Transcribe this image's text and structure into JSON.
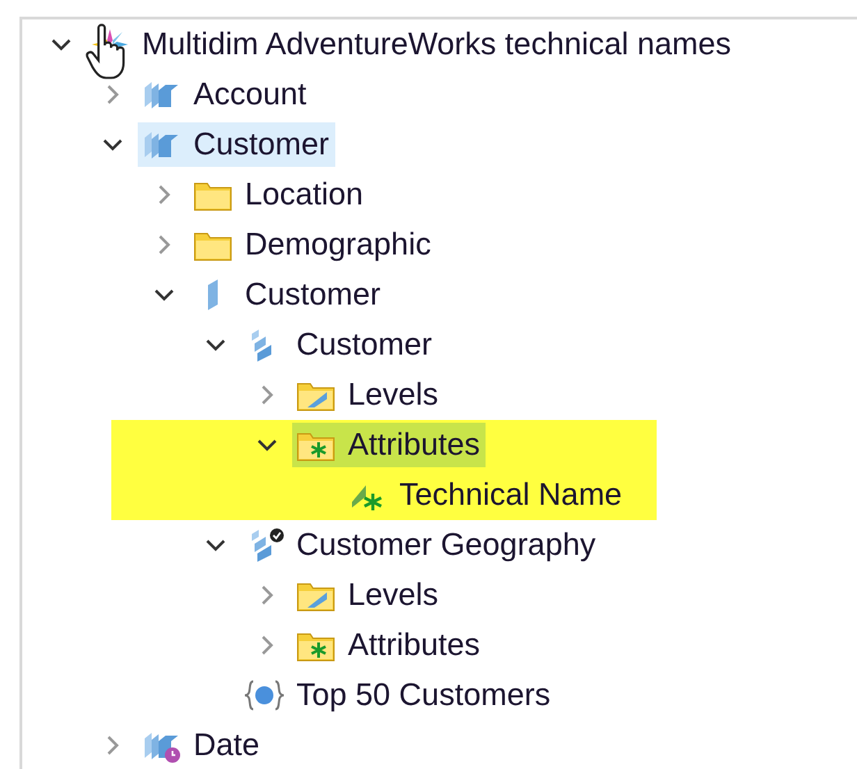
{
  "tree": [
    {
      "label": "Multidim AdventureWorks technical names",
      "kind": "project",
      "expanded": true,
      "selected": false,
      "highlighted": false,
      "children": [
        {
          "label": "Account",
          "kind": "cube",
          "expanded": false,
          "selected": false,
          "highlighted": false
        },
        {
          "label": "Customer",
          "kind": "cube",
          "expanded": true,
          "selected": true,
          "highlighted": false,
          "children": [
            {
              "label": "Location",
              "kind": "folder",
              "expanded": false,
              "selected": false,
              "highlighted": false
            },
            {
              "label": "Demographic",
              "kind": "folder",
              "expanded": false,
              "selected": false,
              "highlighted": false
            },
            {
              "label": "Customer",
              "kind": "dimension",
              "expanded": true,
              "selected": false,
              "highlighted": false,
              "children": [
                {
                  "label": "Customer",
                  "kind": "hierarchy",
                  "expanded": true,
                  "selected": false,
                  "highlighted": false,
                  "children": [
                    {
                      "label": "Levels",
                      "kind": "levels-folder",
                      "expanded": false,
                      "selected": false,
                      "highlighted": false
                    },
                    {
                      "label": "Attributes",
                      "kind": "attributes-folder",
                      "expanded": true,
                      "selected": true,
                      "highlighted": true,
                      "children": [
                        {
                          "label": "Technical Name",
                          "kind": "attribute",
                          "selected": false,
                          "highlighted": true
                        }
                      ]
                    }
                  ]
                },
                {
                  "label": "Customer Geography",
                  "kind": "default-hierarchy",
                  "expanded": true,
                  "selected": false,
                  "highlighted": false,
                  "children": [
                    {
                      "label": "Levels",
                      "kind": "levels-folder",
                      "expanded": false,
                      "selected": false,
                      "highlighted": false
                    },
                    {
                      "label": "Attributes",
                      "kind": "attributes-folder",
                      "expanded": false,
                      "selected": false,
                      "highlighted": false
                    }
                  ]
                },
                {
                  "label": "Top 50 Customers",
                  "kind": "named-set",
                  "selected": false,
                  "highlighted": false
                }
              ]
            }
          ]
        },
        {
          "label": "Date",
          "kind": "time-cube",
          "expanded": false,
          "selected": false,
          "highlighted": false
        }
      ]
    }
  ]
}
